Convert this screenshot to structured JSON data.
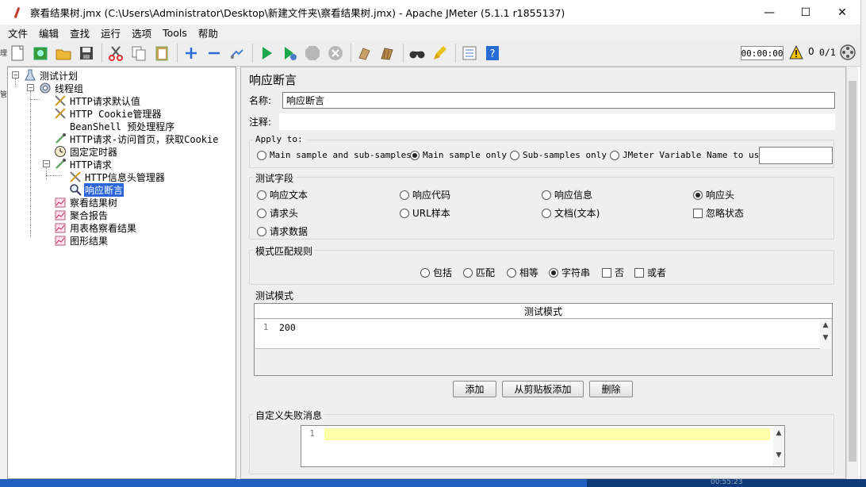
{
  "window": {
    "title": "察看结果树.jmx (C:\\Users\\Administrator\\Desktop\\新建文件夹\\察看结果树.jmx) - Apache JMeter (5.1.1 r1855137)",
    "minimize": "—",
    "maximize": "☐",
    "close": "✕"
  },
  "menu": [
    "文件",
    "编辑",
    "查找",
    "运行",
    "选项",
    "Tools",
    "帮助"
  ],
  "toolbar": {
    "icons": [
      "new-icon",
      "templates-icon",
      "open-icon",
      "save-icon",
      "cut-icon",
      "copy-icon",
      "paste-icon",
      "expand-icon",
      "collapse-icon",
      "toggle-icon",
      "start-icon",
      "start-no-pause-icon",
      "stop-icon",
      "shutdown-icon",
      "clear-icon",
      "clear-all-icon",
      "search-icon",
      "reset-search-icon",
      "function-helper-icon",
      "help-icon"
    ],
    "timer": "00:00:00",
    "warning_count": "0",
    "threads": "0/1"
  },
  "tree": [
    {
      "label": "测试计划",
      "icon": "test-plan-icon"
    },
    {
      "label": "线程组",
      "icon": "gear-icon"
    },
    {
      "label": "HTTP请求默认值",
      "icon": "wrench-icon"
    },
    {
      "label": "HTTP Cookie管理器",
      "icon": "wrench-icon"
    },
    {
      "label": "BeanShell 预处理程序",
      "icon": "none"
    },
    {
      "label": "HTTP请求-访问首页，获取Cookie",
      "icon": "pipette-icon"
    },
    {
      "label": "固定定时器",
      "icon": "clock-icon"
    },
    {
      "label": "HTTP请求",
      "icon": "pipette-icon"
    },
    {
      "label": "HTTP信息头管理器",
      "icon": "wrench-icon"
    },
    {
      "label": "响应断言",
      "icon": "magnifier-icon"
    },
    {
      "label": "察看结果树",
      "icon": "chart-icon"
    },
    {
      "label": "聚合报告",
      "icon": "chart-icon"
    },
    {
      "label": "用表格察看结果",
      "icon": "chart-icon"
    },
    {
      "label": "图形结果",
      "icon": "chart-icon"
    }
  ],
  "left_gutter": [
    "理",
    "管"
  ],
  "panel": {
    "title": "响应断言",
    "name_label": "名称:",
    "name_value": "响应断言",
    "comment_label": "注释:",
    "comment_value": "",
    "apply_to": {
      "title": "Apply to:",
      "options": [
        "Main sample and sub-samples",
        "Main sample only",
        "Sub-samples only",
        "JMeter Variable Name to use"
      ],
      "selected": "Main sample only",
      "variable_value": ""
    },
    "test_field": {
      "title": "测试字段",
      "options": [
        "响应文本",
        "响应代码",
        "响应信息",
        "响应头",
        "请求头",
        "URL样本",
        "文档(文本)",
        "请求数据"
      ],
      "selected": "响应头",
      "ignore_status": "忽略状态"
    },
    "match_rules": {
      "title": "模式匹配规则",
      "options": [
        "包括",
        "匹配",
        "相等",
        "字符串"
      ],
      "selected": "字符串",
      "not_label": "否",
      "or_label": "或者"
    },
    "patterns": {
      "title": "测试模式",
      "column": "测试模式",
      "rows": [
        {
          "line": "1",
          "value": "200"
        }
      ],
      "scroll_up": "▲",
      "scroll_down": "▼"
    },
    "buttons": {
      "add": "添加",
      "add_clipboard": "从剪贴板添加",
      "delete": "删除"
    },
    "failure_message": {
      "title": "自定义失败消息",
      "line": "1",
      "value": ""
    }
  },
  "taskbar": {
    "time": "00:55:23"
  }
}
